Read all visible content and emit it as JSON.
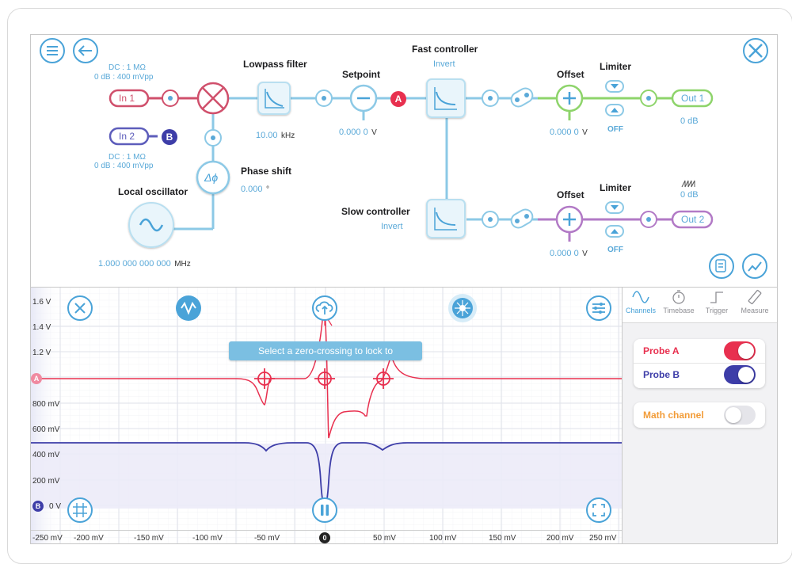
{
  "diagram": {
    "in1": {
      "label": "In 1",
      "coupling": "DC : 1 MΩ",
      "range": "0 dB : 400 mVpp"
    },
    "in2": {
      "label": "In 2",
      "coupling": "DC : 1 MΩ",
      "range": "0 dB : 400 mVpp"
    },
    "probe_a_marker": "A",
    "probe_b_marker": "B",
    "lowpass_filter": {
      "title": "Lowpass filter",
      "value": "10.00",
      "unit": "kHz"
    },
    "setpoint": {
      "title": "Setpoint",
      "value": "0.000 0",
      "unit": "V"
    },
    "fast_controller": {
      "title": "Fast controller",
      "mode": "Invert"
    },
    "slow_controller": {
      "title": "Slow controller",
      "mode": "Invert"
    },
    "phase_shift": {
      "title": "Phase shift",
      "value": "0.000",
      "unit": "°"
    },
    "phase_symbol": "Δϕ",
    "local_oscillator": {
      "title": "Local oscillator",
      "value": "1.000 000 000 000",
      "unit": "MHz"
    },
    "offset1": {
      "title": "Offset",
      "value": "0.000 0",
      "unit": "V"
    },
    "offset2": {
      "title": "Offset",
      "value": "0.000 0",
      "unit": "V"
    },
    "limiter1": {
      "title": "Limiter",
      "state": "OFF"
    },
    "limiter2": {
      "title": "Limiter",
      "state": "OFF"
    },
    "out1": {
      "label": "Out 1",
      "gain": "0 dB"
    },
    "out2": {
      "label": "Out 2",
      "gain": "0 dB"
    }
  },
  "scope": {
    "y_labels": [
      "1.6 V",
      "1.4 V",
      "1.2 V",
      "800 mV",
      "600 mV",
      "400 mV",
      "200 mV",
      "0 V"
    ],
    "x_labels": [
      "-250 mV",
      "-200 mV",
      "-150 mV",
      "-100 mV",
      "-50 mV",
      "50 mV",
      "100 mV",
      "150 mV",
      "200 mV",
      "250 mV"
    ],
    "x_zero_marker": "0",
    "probe_a_axis_marker": "A",
    "probe_b_axis_marker": "B",
    "tooltip": "Select a zero-crossing to lock to",
    "colors": {
      "probe_a": "#e8304f",
      "probe_b": "#3d3da8",
      "accent": "#4aa3d8"
    }
  },
  "sidebar": {
    "tabs": [
      {
        "label": "Channels",
        "icon": "sine-wave-icon"
      },
      {
        "label": "Timebase",
        "icon": "stopwatch-icon"
      },
      {
        "label": "Trigger",
        "icon": "trigger-edge-icon"
      },
      {
        "label": "Measure",
        "icon": "ruler-icon"
      }
    ],
    "probe_a": {
      "label": "Probe A",
      "enabled": true
    },
    "probe_b": {
      "label": "Probe B",
      "enabled": true
    },
    "math_channel": {
      "label": "Math channel",
      "enabled": false
    }
  }
}
